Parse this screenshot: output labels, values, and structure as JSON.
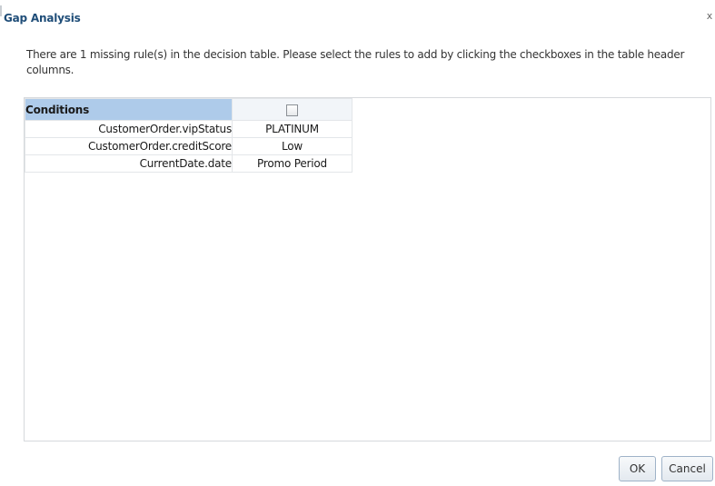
{
  "dialog": {
    "title": "Gap Analysis",
    "close_glyph": "x",
    "message": "There are 1 missing rule(s) in the decision table. Please select the rules to add by clicking the checkboxes in the table header columns."
  },
  "table": {
    "header_label": "Conditions",
    "rule_checkbox_checked": false,
    "rows": [
      {
        "condition": "CustomerOrder.vipStatus",
        "value": "PLATINUM"
      },
      {
        "condition": "CustomerOrder.creditScore",
        "value": "Low"
      },
      {
        "condition": "CurrentDate.date",
        "value": "Promo Period"
      }
    ]
  },
  "buttons": {
    "ok_label": "OK",
    "cancel_label": "Cancel"
  },
  "colors": {
    "title": "#1f4d78",
    "conditions_header_bg": "#aecbea",
    "rule_header_bg": "#f2f5f9",
    "button_border": "#9fb3c8"
  }
}
